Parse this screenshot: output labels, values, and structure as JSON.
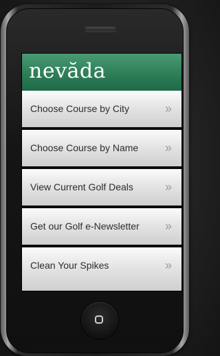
{
  "app": {
    "brand": "nevăda"
  },
  "menu": {
    "items": [
      {
        "label": "Choose Course by City",
        "chevron": "»"
      },
      {
        "label": "Choose Course by Name",
        "chevron": "»"
      },
      {
        "label": "View Current Golf Deals",
        "chevron": "»"
      },
      {
        "label": "Get our Golf e-Newsletter",
        "chevron": "»"
      },
      {
        "label": "Clean Your Spikes",
        "chevron": "»"
      }
    ]
  },
  "device": {
    "home_button_icon": "home-square-icon"
  },
  "colors": {
    "header_green": "#2e7e58",
    "menu_text": "#2d2d2d",
    "chevron": "#9a9a9a"
  }
}
